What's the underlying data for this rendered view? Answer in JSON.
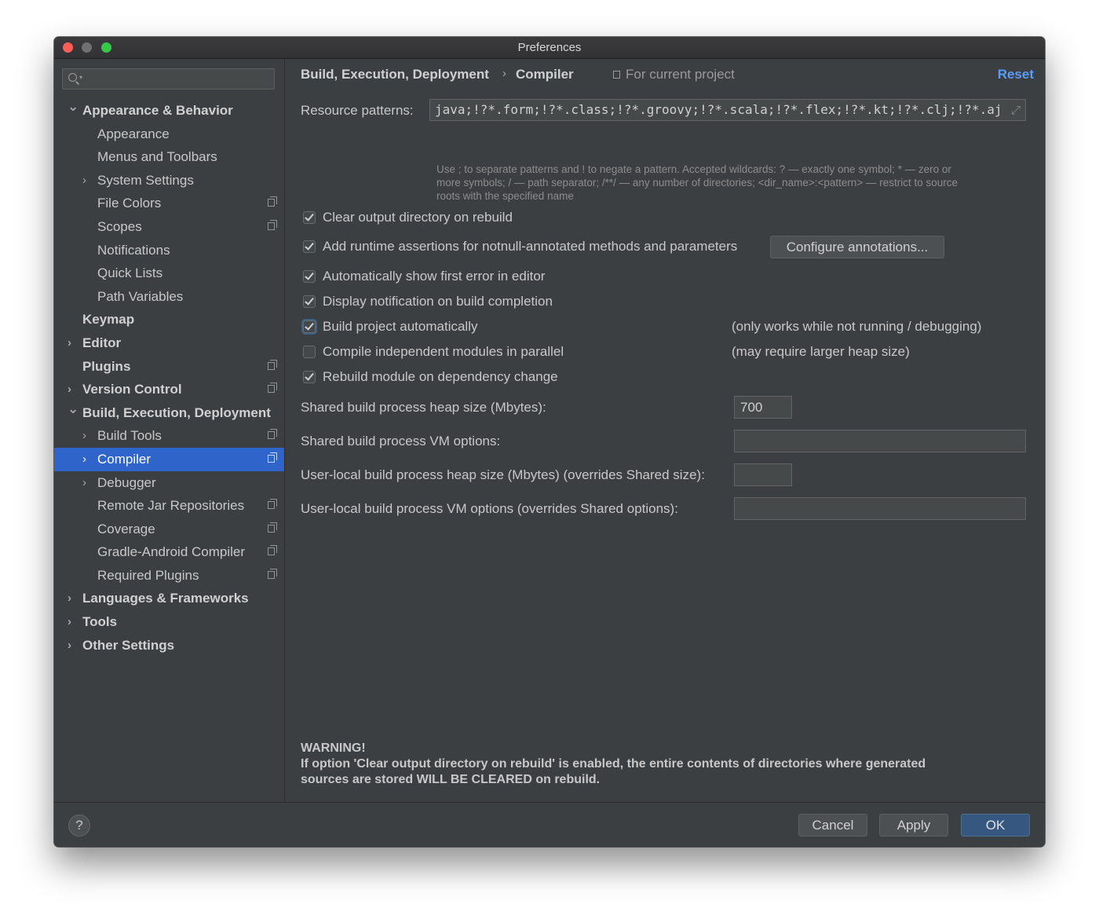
{
  "window": {
    "title": "Preferences"
  },
  "sidebar": {
    "search": {
      "value": ""
    },
    "items": [
      {
        "label": "Appearance & Behavior",
        "level": 0,
        "chevron": "down",
        "bold": true
      },
      {
        "label": "Appearance",
        "level": 1
      },
      {
        "label": "Menus and Toolbars",
        "level": 1
      },
      {
        "label": "System Settings",
        "level": 1,
        "chevron": "right"
      },
      {
        "label": "File Colors",
        "level": 1,
        "project": true
      },
      {
        "label": "Scopes",
        "level": 1,
        "project": true
      },
      {
        "label": "Notifications",
        "level": 1
      },
      {
        "label": "Quick Lists",
        "level": 1
      },
      {
        "label": "Path Variables",
        "level": 1
      },
      {
        "label": "Keymap",
        "level": 0,
        "bold": true
      },
      {
        "label": "Editor",
        "level": 0,
        "chevron": "right",
        "bold": true
      },
      {
        "label": "Plugins",
        "level": 0,
        "bold": true,
        "project": true
      },
      {
        "label": "Version Control",
        "level": 0,
        "chevron": "right",
        "bold": true,
        "project": true
      },
      {
        "label": "Build, Execution, Deployment",
        "level": 0,
        "chevron": "down",
        "bold": true
      },
      {
        "label": "Build Tools",
        "level": 1,
        "chevron": "right",
        "project": true
      },
      {
        "label": "Compiler",
        "level": 1,
        "chevron": "right",
        "project": true,
        "selected": true
      },
      {
        "label": "Debugger",
        "level": 1,
        "chevron": "right"
      },
      {
        "label": "Remote Jar Repositories",
        "level": 1,
        "project": true
      },
      {
        "label": "Coverage",
        "level": 1,
        "project": true
      },
      {
        "label": "Gradle-Android Compiler",
        "level": 1,
        "project": true
      },
      {
        "label": "Required Plugins",
        "level": 1,
        "project": true
      },
      {
        "label": "Languages & Frameworks",
        "level": 0,
        "chevron": "right",
        "bold": true
      },
      {
        "label": "Tools",
        "level": 0,
        "chevron": "right",
        "bold": true
      },
      {
        "label": "Other Settings",
        "level": 0,
        "chevron": "right",
        "bold": true
      }
    ]
  },
  "header": {
    "crumb1": "Build, Execution, Deployment",
    "separator": "›",
    "crumb2": "Compiler",
    "scope": "For current project",
    "reset": "Reset"
  },
  "resource_patterns": {
    "label": "Resource patterns:",
    "value": "java;!?*.form;!?*.class;!?*.groovy;!?*.scala;!?*.flex;!?*.kt;!?*.clj;!?*.aj",
    "hint_line1": "Use ; to separate patterns and ! to negate a pattern. Accepted wildcards: ? — exactly one symbol; * — zero or",
    "hint_line2": "more symbols; / — path separator; /**/ — any number of directories; <dir_name>:<pattern> — restrict to source",
    "hint_line3": "roots with the specified name"
  },
  "options": {
    "clear_output": {
      "label": "Clear output directory on rebuild",
      "checked": true
    },
    "runtime_assertions": {
      "label": "Add runtime assertions for notnull-annotated methods and parameters",
      "checked": true
    },
    "configure_button": "Configure annotations...",
    "show_first_error": {
      "label": "Automatically show first error in editor",
      "checked": true
    },
    "display_notification": {
      "label": "Display notification on build completion",
      "checked": true
    },
    "build_auto": {
      "label": "Build project automatically",
      "checked": true,
      "note": "(only works while not running / debugging)"
    },
    "compile_parallel": {
      "label": "Compile independent modules in parallel",
      "checked": false,
      "note": "(may require larger heap size)"
    },
    "rebuild_dep": {
      "label": "Rebuild module on dependency change",
      "checked": true
    }
  },
  "fields": {
    "shared_heap": {
      "label": "Shared build process heap size (Mbytes):",
      "value": "700"
    },
    "shared_vm": {
      "label": "Shared build process VM options:",
      "value": ""
    },
    "user_heap": {
      "label": "User-local build process heap size (Mbytes) (overrides Shared size):",
      "value": ""
    },
    "user_vm": {
      "label": "User-local build process VM options (overrides Shared options):",
      "value": ""
    }
  },
  "warning": {
    "title": "WARNING!",
    "line1": "If option 'Clear output directory on rebuild' is enabled, the entire contents of directories where generated",
    "line2": "sources are stored WILL BE CLEARED on rebuild."
  },
  "footer": {
    "help": "?",
    "cancel": "Cancel",
    "apply": "Apply",
    "ok": "OK"
  }
}
